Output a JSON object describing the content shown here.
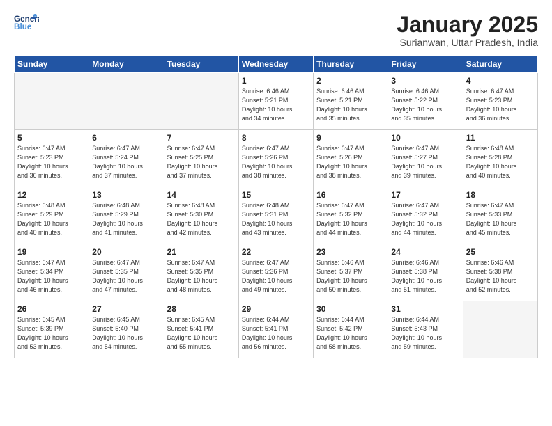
{
  "header": {
    "logo_general": "General",
    "logo_blue": "Blue",
    "month_title": "January 2025",
    "subtitle": "Surianwan, Uttar Pradesh, India"
  },
  "weekdays": [
    "Sunday",
    "Monday",
    "Tuesday",
    "Wednesday",
    "Thursday",
    "Friday",
    "Saturday"
  ],
  "weeks": [
    [
      {
        "day": "",
        "info": ""
      },
      {
        "day": "",
        "info": ""
      },
      {
        "day": "",
        "info": ""
      },
      {
        "day": "1",
        "info": "Sunrise: 6:46 AM\nSunset: 5:21 PM\nDaylight: 10 hours\nand 34 minutes."
      },
      {
        "day": "2",
        "info": "Sunrise: 6:46 AM\nSunset: 5:21 PM\nDaylight: 10 hours\nand 35 minutes."
      },
      {
        "day": "3",
        "info": "Sunrise: 6:46 AM\nSunset: 5:22 PM\nDaylight: 10 hours\nand 35 minutes."
      },
      {
        "day": "4",
        "info": "Sunrise: 6:47 AM\nSunset: 5:23 PM\nDaylight: 10 hours\nand 36 minutes."
      }
    ],
    [
      {
        "day": "5",
        "info": "Sunrise: 6:47 AM\nSunset: 5:23 PM\nDaylight: 10 hours\nand 36 minutes."
      },
      {
        "day": "6",
        "info": "Sunrise: 6:47 AM\nSunset: 5:24 PM\nDaylight: 10 hours\nand 37 minutes."
      },
      {
        "day": "7",
        "info": "Sunrise: 6:47 AM\nSunset: 5:25 PM\nDaylight: 10 hours\nand 37 minutes."
      },
      {
        "day": "8",
        "info": "Sunrise: 6:47 AM\nSunset: 5:26 PM\nDaylight: 10 hours\nand 38 minutes."
      },
      {
        "day": "9",
        "info": "Sunrise: 6:47 AM\nSunset: 5:26 PM\nDaylight: 10 hours\nand 38 minutes."
      },
      {
        "day": "10",
        "info": "Sunrise: 6:47 AM\nSunset: 5:27 PM\nDaylight: 10 hours\nand 39 minutes."
      },
      {
        "day": "11",
        "info": "Sunrise: 6:48 AM\nSunset: 5:28 PM\nDaylight: 10 hours\nand 40 minutes."
      }
    ],
    [
      {
        "day": "12",
        "info": "Sunrise: 6:48 AM\nSunset: 5:29 PM\nDaylight: 10 hours\nand 40 minutes."
      },
      {
        "day": "13",
        "info": "Sunrise: 6:48 AM\nSunset: 5:29 PM\nDaylight: 10 hours\nand 41 minutes."
      },
      {
        "day": "14",
        "info": "Sunrise: 6:48 AM\nSunset: 5:30 PM\nDaylight: 10 hours\nand 42 minutes."
      },
      {
        "day": "15",
        "info": "Sunrise: 6:48 AM\nSunset: 5:31 PM\nDaylight: 10 hours\nand 43 minutes."
      },
      {
        "day": "16",
        "info": "Sunrise: 6:47 AM\nSunset: 5:32 PM\nDaylight: 10 hours\nand 44 minutes."
      },
      {
        "day": "17",
        "info": "Sunrise: 6:47 AM\nSunset: 5:32 PM\nDaylight: 10 hours\nand 44 minutes."
      },
      {
        "day": "18",
        "info": "Sunrise: 6:47 AM\nSunset: 5:33 PM\nDaylight: 10 hours\nand 45 minutes."
      }
    ],
    [
      {
        "day": "19",
        "info": "Sunrise: 6:47 AM\nSunset: 5:34 PM\nDaylight: 10 hours\nand 46 minutes."
      },
      {
        "day": "20",
        "info": "Sunrise: 6:47 AM\nSunset: 5:35 PM\nDaylight: 10 hours\nand 47 minutes."
      },
      {
        "day": "21",
        "info": "Sunrise: 6:47 AM\nSunset: 5:35 PM\nDaylight: 10 hours\nand 48 minutes."
      },
      {
        "day": "22",
        "info": "Sunrise: 6:47 AM\nSunset: 5:36 PM\nDaylight: 10 hours\nand 49 minutes."
      },
      {
        "day": "23",
        "info": "Sunrise: 6:46 AM\nSunset: 5:37 PM\nDaylight: 10 hours\nand 50 minutes."
      },
      {
        "day": "24",
        "info": "Sunrise: 6:46 AM\nSunset: 5:38 PM\nDaylight: 10 hours\nand 51 minutes."
      },
      {
        "day": "25",
        "info": "Sunrise: 6:46 AM\nSunset: 5:38 PM\nDaylight: 10 hours\nand 52 minutes."
      }
    ],
    [
      {
        "day": "26",
        "info": "Sunrise: 6:45 AM\nSunset: 5:39 PM\nDaylight: 10 hours\nand 53 minutes."
      },
      {
        "day": "27",
        "info": "Sunrise: 6:45 AM\nSunset: 5:40 PM\nDaylight: 10 hours\nand 54 minutes."
      },
      {
        "day": "28",
        "info": "Sunrise: 6:45 AM\nSunset: 5:41 PM\nDaylight: 10 hours\nand 55 minutes."
      },
      {
        "day": "29",
        "info": "Sunrise: 6:44 AM\nSunset: 5:41 PM\nDaylight: 10 hours\nand 56 minutes."
      },
      {
        "day": "30",
        "info": "Sunrise: 6:44 AM\nSunset: 5:42 PM\nDaylight: 10 hours\nand 58 minutes."
      },
      {
        "day": "31",
        "info": "Sunrise: 6:44 AM\nSunset: 5:43 PM\nDaylight: 10 hours\nand 59 minutes."
      },
      {
        "day": "",
        "info": ""
      }
    ]
  ]
}
